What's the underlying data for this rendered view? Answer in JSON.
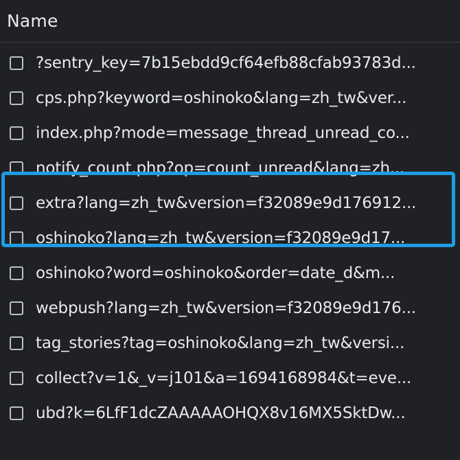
{
  "header": {
    "name_column": "Name"
  },
  "requests": [
    {
      "name": "?sentry_key=7b15ebdd9cf64efb88cfab93783d..."
    },
    {
      "name": "cps.php?keyword=oshinoko&lang=zh_tw&ver..."
    },
    {
      "name": "index.php?mode=message_thread_unread_co..."
    },
    {
      "name": "notify_count.php?op=count_unread&lang=zh..."
    },
    {
      "name": "extra?lang=zh_tw&version=f32089e9d176912..."
    },
    {
      "name": "oshinoko?lang=zh_tw&version=f32089e9d17..."
    },
    {
      "name": "oshinoko?word=oshinoko&order=date_d&m..."
    },
    {
      "name": "webpush?lang=zh_tw&version=f32089e9d176..."
    },
    {
      "name": "tag_stories?tag=oshinoko&lang=zh_tw&versi..."
    },
    {
      "name": "collect?v=1&_v=j101&a=1694168984&t=eve..."
    },
    {
      "name": "ubd?k=6LfF1dcZAAAAAOHQX8v16MX5SktDw..."
    }
  ],
  "highlight": {
    "color": "#1e9ce6",
    "rows": [
      5,
      6
    ]
  },
  "colors": {
    "background": "#202124",
    "text": "#e8eaed",
    "checkbox_border": "#bdc1c6"
  }
}
